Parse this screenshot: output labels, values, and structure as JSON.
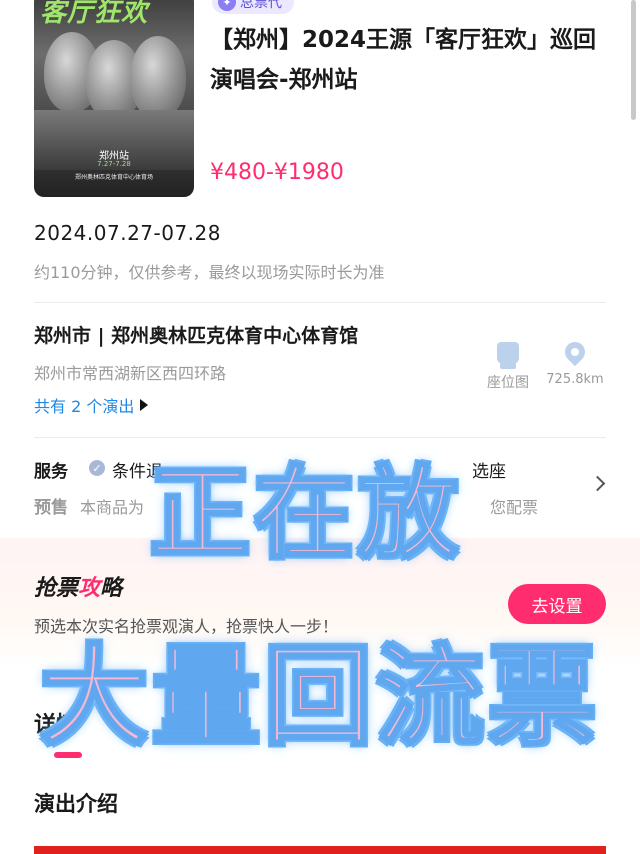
{
  "poster": {
    "title_text": "客厅狂欢",
    "city": "郑州站",
    "date": "7.27-7.28",
    "venue": "郑州奥林匹克体育中心体育场"
  },
  "seller_badge": {
    "label": "总票代",
    "icon": "seller-icon"
  },
  "event": {
    "title": "【郑州】2024王源「客厅狂欢」巡回演唱会-郑州站",
    "price": "¥480-¥1980",
    "date_range": "2024.07.27-07.28",
    "duration_note": "约110分钟，仅供参考，最终以现场实际时长为准"
  },
  "venue": {
    "name": "郑州市 | 郑州奥林匹克体育中心体育馆",
    "address": "郑州市常西湖新区西四环路",
    "shows_link": "共有 2 个演出",
    "seat_map_label": "座位图",
    "distance": "725.8km"
  },
  "service": {
    "label": "服务",
    "text": "条件退",
    "text_right": "选座",
    "presale_label": "预售",
    "presale_text": "本商品为",
    "presale_text_right": "您配票"
  },
  "strategy": {
    "title_prefix": "抢票",
    "title_highlight": "攻",
    "title_suffix": "略",
    "description": "预选本次实名抢票观演人，抢票快人一步！",
    "button_label": "去设置"
  },
  "tabs": {
    "detail": "详情"
  },
  "intro_heading": "演出介绍",
  "overlay": {
    "line1": "正在放",
    "line2": "大量回流票"
  },
  "colors": {
    "accent": "#ff2d6f",
    "link": "#1e88e5",
    "overlay_fill": "#f6b7d3",
    "overlay_stroke": "#5fa8f0"
  }
}
